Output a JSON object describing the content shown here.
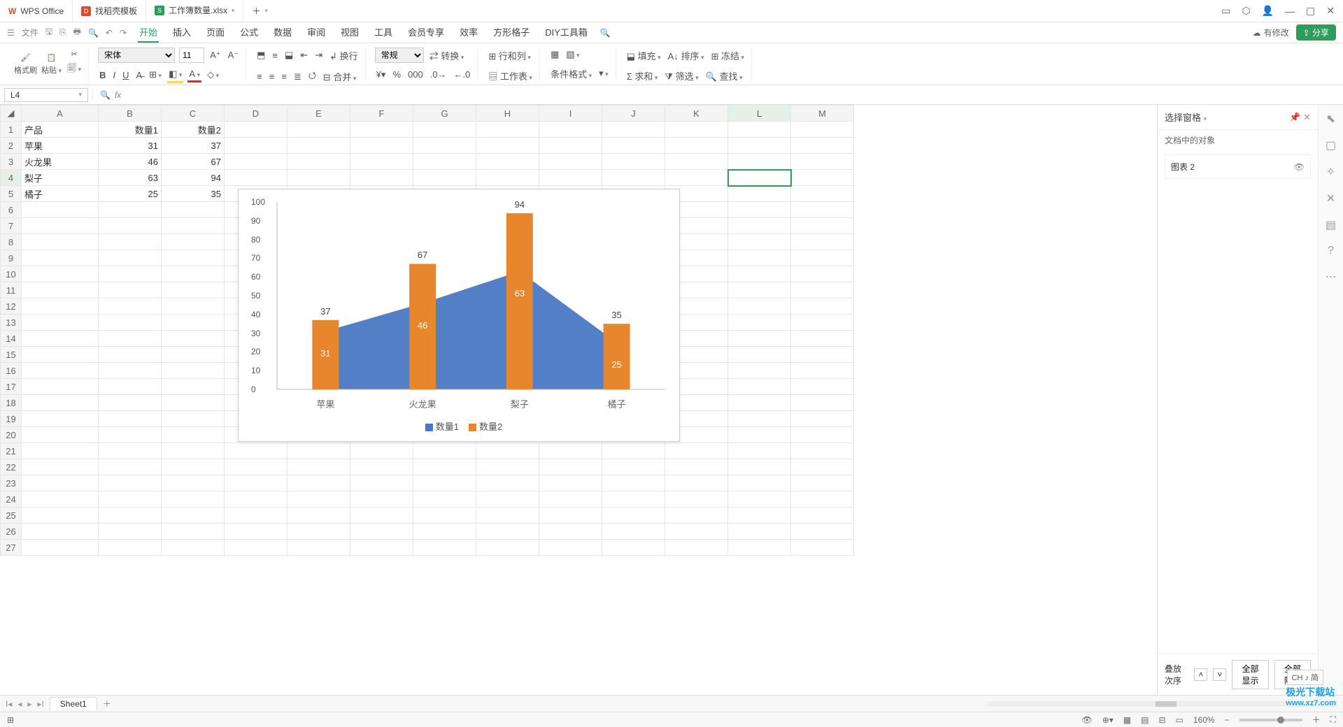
{
  "app": {
    "name": "WPS Office"
  },
  "tabs": [
    {
      "label": "WPS Office",
      "icon": "wps"
    },
    {
      "label": "找稻壳模板",
      "icon": "pdf"
    },
    {
      "label": "工作簿数量.xlsx",
      "icon": "xls",
      "dirty": "•"
    }
  ],
  "menubar": {
    "file": "文件",
    "items": [
      "开始",
      "插入",
      "页面",
      "公式",
      "数据",
      "审阅",
      "视图",
      "工具",
      "会员专享",
      "效率",
      "方形格子",
      "DIY工具箱"
    ],
    "active": "开始",
    "has_modify": "有修改",
    "share": "分享"
  },
  "ribbon": {
    "format_brush": "格式刷",
    "paste": "粘贴",
    "font_name": "宋体",
    "font_size": "11",
    "wrap": "换行",
    "general": "常规",
    "convert": "转换",
    "rowcol": "行和列",
    "worksheet": "工作表",
    "condfmt": "条件格式",
    "fill": "填充",
    "sort": "排序",
    "freeze": "冻结",
    "sum": "求和",
    "filter": "筛选",
    "find": "查找",
    "merge": "合并"
  },
  "formula": {
    "cell_ref": "L4",
    "fx": "fx"
  },
  "sheet": {
    "columns": [
      "A",
      "B",
      "C",
      "D",
      "E",
      "F",
      "G",
      "H",
      "I",
      "J",
      "K",
      "L",
      "M"
    ],
    "rows": 27,
    "selected": {
      "col": "L",
      "row": 4
    },
    "data": {
      "A1": "产品",
      "B1": "数量1",
      "C1": "数量2",
      "A2": "苹果",
      "B2": "31",
      "C2": "37",
      "A3": "火龙果",
      "B3": "46",
      "C3": "67",
      "A4": "梨子",
      "B4": "63",
      "C4": "94",
      "A5": "橘子",
      "B5": "25",
      "C5": "35"
    },
    "tab_name": "Sheet1"
  },
  "sidepanel": {
    "title": "选择窗格",
    "subtitle": "文档中的对象",
    "item": "图表 2",
    "stack_order": "叠放次序",
    "show_all": "全部显示",
    "hide_all": "全部隐藏"
  },
  "statusbar": {
    "zoom": "160%"
  },
  "ime": "CH ♪ 简",
  "watermark": {
    "l1": "极光下载站",
    "l2": "www.xz7.com"
  },
  "chart_data": {
    "type": "bar+area",
    "categories": [
      "苹果",
      "火龙果",
      "梨子",
      "橘子"
    ],
    "series": [
      {
        "name": "数量1",
        "type": "area",
        "color": "#4a78c4",
        "values": [
          31,
          46,
          63,
          25
        ]
      },
      {
        "name": "数量2",
        "type": "bar",
        "color": "#e8862e",
        "values": [
          37,
          67,
          94,
          35
        ]
      }
    ],
    "ylim": [
      0,
      100
    ],
    "yticks": [
      0,
      10,
      20,
      30,
      40,
      50,
      60,
      70,
      80,
      90,
      100
    ],
    "legend": [
      "数量1",
      "数量2"
    ]
  }
}
